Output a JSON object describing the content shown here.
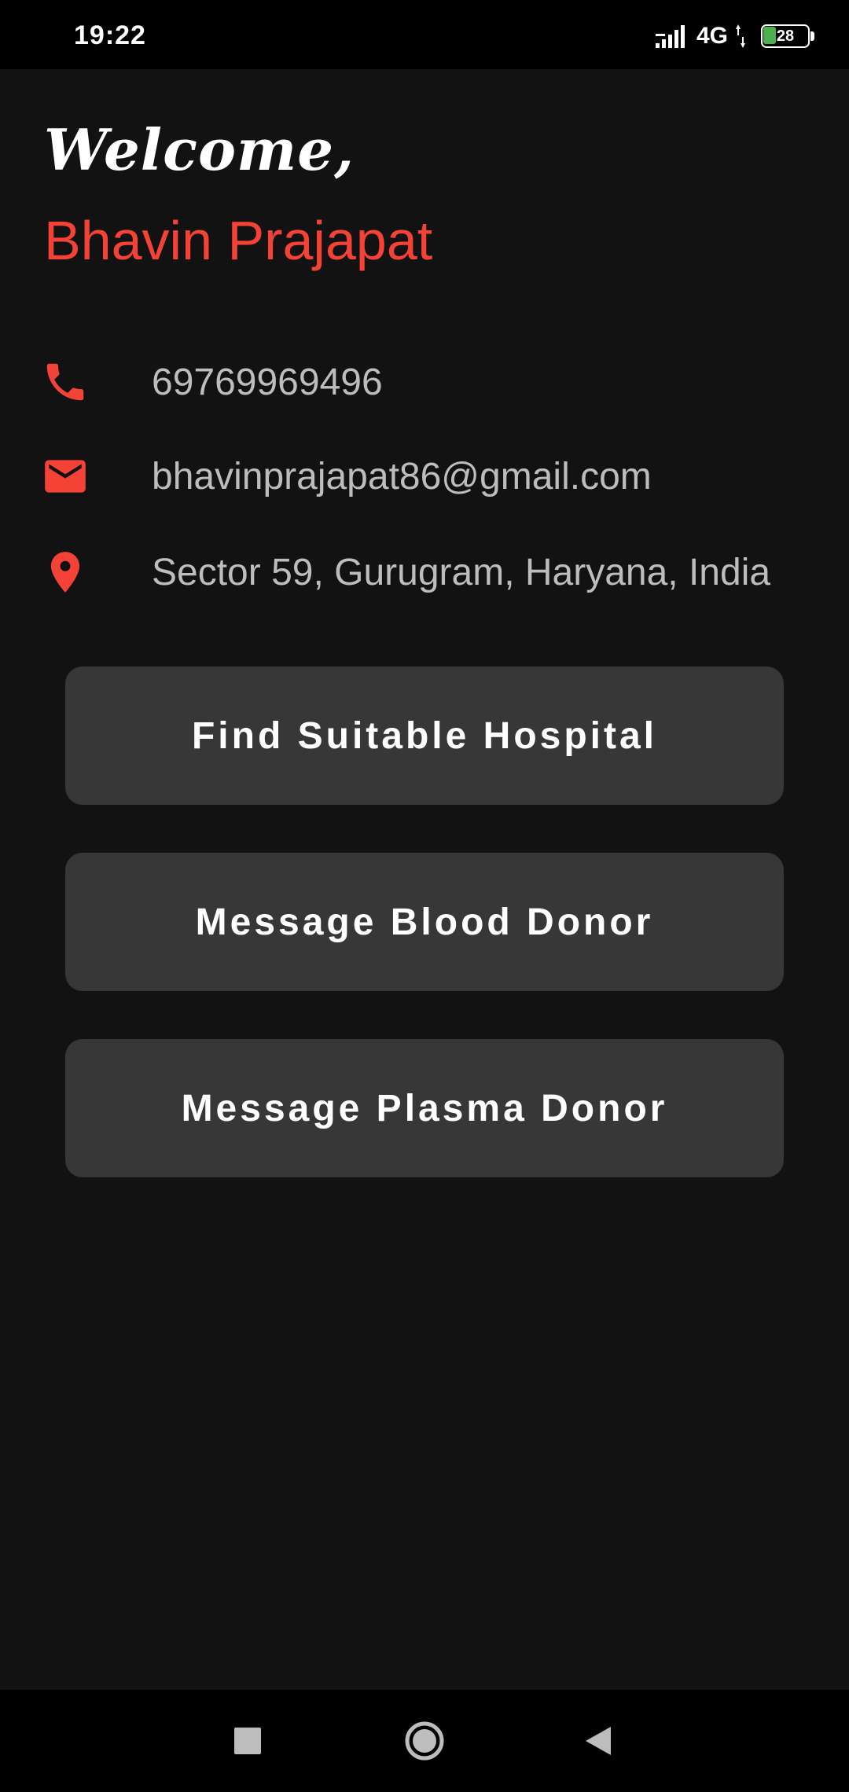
{
  "status_bar": {
    "time": "19:22",
    "network": "4G",
    "battery_level": "28",
    "battery_fraction": 0.28
  },
  "profile": {
    "welcome": "Welcome,",
    "name": "Bhavin Prajapat",
    "phone": "69769969496",
    "email": "bhavinprajapat86@gmail.com",
    "address": "Sector 59, Gurugram, Haryana, India"
  },
  "icons": {
    "phone": "phone-icon",
    "email": "mail-icon",
    "address": "location-pin-icon"
  },
  "actions": {
    "find_hospital": "Find Suitable Hospital",
    "message_blood_donor": "Message Blood Donor",
    "message_plasma_donor": "Message Plasma Donor"
  },
  "colors": {
    "accent": "#f44336",
    "background": "#121212",
    "button": "#373737",
    "battery": "#4caf50"
  }
}
